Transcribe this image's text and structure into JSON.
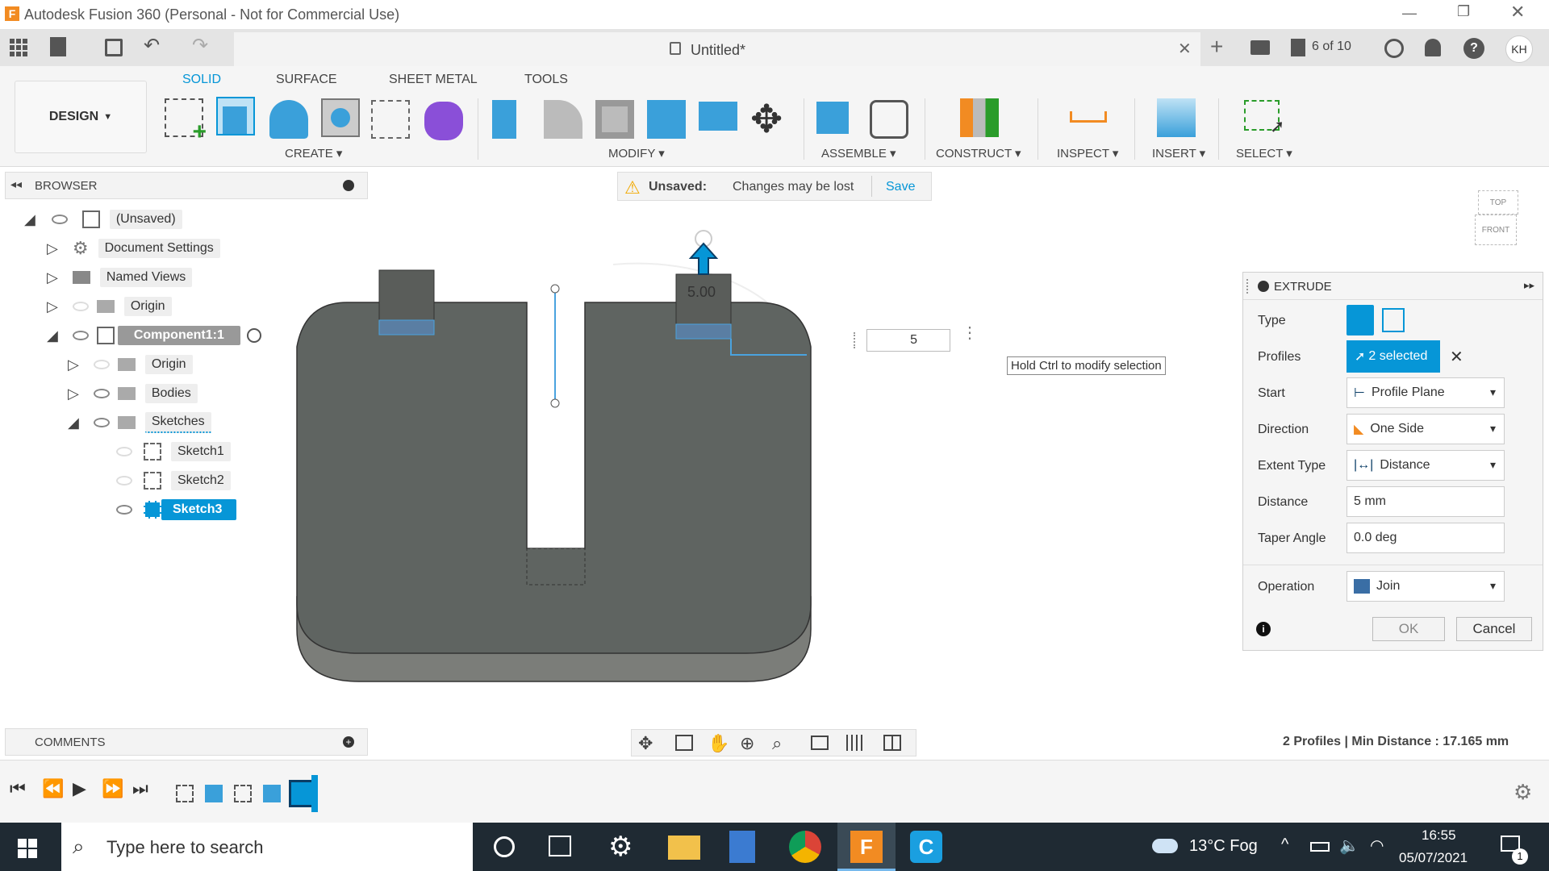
{
  "app": {
    "title": "Autodesk Fusion 360 (Personal - Not for Commercial Use)"
  },
  "tabbar": {
    "doc_title": "Untitled*",
    "jobs": "6 of 10",
    "user": "KH"
  },
  "ribbon": {
    "workspace": "DESIGN",
    "tabs": [
      "SOLID",
      "SURFACE",
      "SHEET METAL",
      "TOOLS"
    ],
    "groups": {
      "create": "CREATE",
      "modify": "MODIFY",
      "assemble": "ASSEMBLE",
      "construct": "CONSTRUCT",
      "inspect": "INSPECT",
      "insert": "INSERT",
      "select": "SELECT"
    }
  },
  "browser": {
    "title": "BROWSER",
    "root": "(Unsaved)",
    "items": [
      "Document Settings",
      "Named Views",
      "Origin",
      "Component1:1",
      "Origin",
      "Bodies",
      "Sketches",
      "Sketch1",
      "Sketch2",
      "Sketch3"
    ]
  },
  "banner": {
    "label": "Unsaved:",
    "message": "Changes may be lost",
    "save": "Save"
  },
  "viewport": {
    "dim_value": "5.00",
    "input_value": "5",
    "tooltip": "Hold Ctrl to modify selection",
    "viewcube": {
      "top": "TOP",
      "front": "FRONT"
    }
  },
  "extrude": {
    "title": "EXTRUDE",
    "type_label": "Type",
    "profiles_label": "Profiles",
    "profiles_value": "2 selected",
    "start_label": "Start",
    "start_value": "Profile Plane",
    "direction_label": "Direction",
    "direction_value": "One Side",
    "extent_label": "Extent Type",
    "extent_value": "Distance",
    "distance_label": "Distance",
    "distance_value": "5 mm",
    "taper_label": "Taper Angle",
    "taper_value": "0.0 deg",
    "operation_label": "Operation",
    "operation_value": "Join",
    "ok": "OK",
    "cancel": "Cancel"
  },
  "comments": {
    "title": "COMMENTS"
  },
  "status": {
    "text": "2 Profiles | Min Distance : 17.165 mm"
  },
  "taskbar": {
    "search_placeholder": "Type here to search",
    "weather": "13°C  Fog",
    "time": "16:55",
    "date": "05/07/2021",
    "notif": "1"
  },
  "colors": {
    "accent": "#0696d7",
    "body": "#5f6461",
    "taskbar": "#1f2a33"
  }
}
